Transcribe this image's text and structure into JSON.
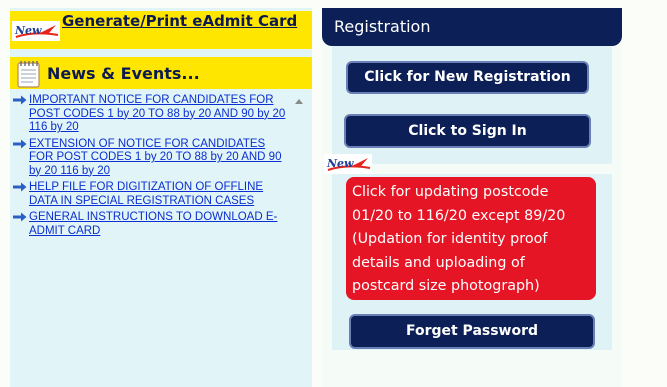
{
  "left": {
    "eadmit_label": "Generate/Print eAdmit Card",
    "news_title": "News & Events...",
    "new_badge": "New",
    "news_items": [
      "IMPORTANT NOTICE FOR CANDIDATES FOR POST CODES 1 by 20 TO 88 by 20 AND 90 by 20 116 by 20",
      "EXTENSION OF NOTICE FOR CANDIDATES FOR POST CODES 1 by 20 TO 88 by 20 AND 90 by 20 116 by 20",
      "HELP FILE FOR DIGITIZATION OF OFFLINE DATA IN SPECIAL REGISTRATION CASES",
      "GENERAL INSTRUCTIONS TO DOWNLOAD E-ADMIT CARD"
    ]
  },
  "right": {
    "title": "Registration",
    "new_registration": "Click for New Registration",
    "sign_in": "Click to Sign In",
    "new_badge": "New",
    "update_postcode": "Click for updating postcode 01/20 to 116/20 except 89/20 (Updation for identity proof details and uploading of postcard size photograph)",
    "forget_password": "Forget Password"
  },
  "colors": {
    "navy": "#0c2057",
    "yellow": "#ffe600",
    "red": "#e51525",
    "link_blue": "#0b2fd0",
    "panel": "#e1f4f7"
  }
}
